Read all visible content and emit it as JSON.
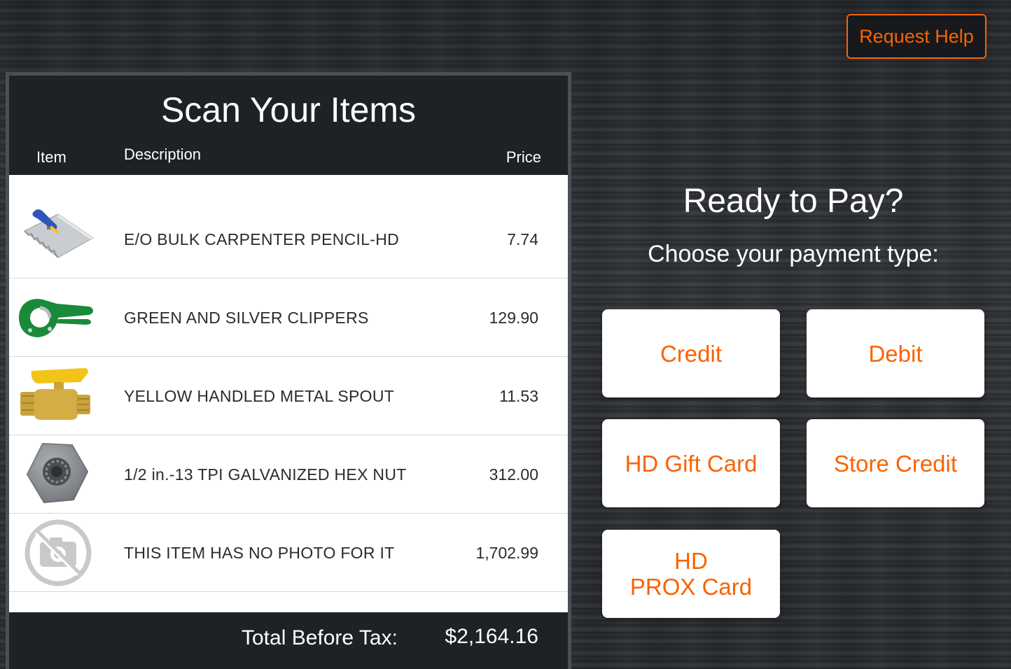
{
  "header": {
    "help_label": "Request Help"
  },
  "scan": {
    "title": "Scan Your Items",
    "columns": {
      "item": "Item",
      "description": "Description",
      "price": "Price"
    },
    "items": [
      {
        "icon": "trowel-icon",
        "description": "E/O BULK CARPENTER PENCIL-HD",
        "price": "7.74"
      },
      {
        "icon": "clippers-icon",
        "description": "GREEN AND SILVER CLIPPERS",
        "price": "129.90"
      },
      {
        "icon": "spout-icon",
        "description": "YELLOW HANDLED METAL SPOUT",
        "price": "11.53"
      },
      {
        "icon": "hex-nut-icon",
        "description": "1/2 in.-13 TPI GALVANIZED HEX NUT",
        "price": "312.00"
      },
      {
        "icon": "no-photo-icon",
        "description": "THIS ITEM HAS NO PHOTO FOR IT",
        "price": "1,702.99"
      }
    ],
    "total_label": "Total Before Tax:",
    "total_value": "$2,164.16"
  },
  "payment": {
    "title": "Ready to Pay?",
    "subtitle": "Choose your payment type:",
    "options": {
      "credit": "Credit",
      "debit": "Debit",
      "gift": "HD Gift Card",
      "store": "Store Credit",
      "prox_line1": "HD",
      "prox_line2": "PROX Card"
    }
  },
  "colors": {
    "accent": "#f96302",
    "panel": "#1e2126",
    "panel_border": "#4b5057"
  }
}
